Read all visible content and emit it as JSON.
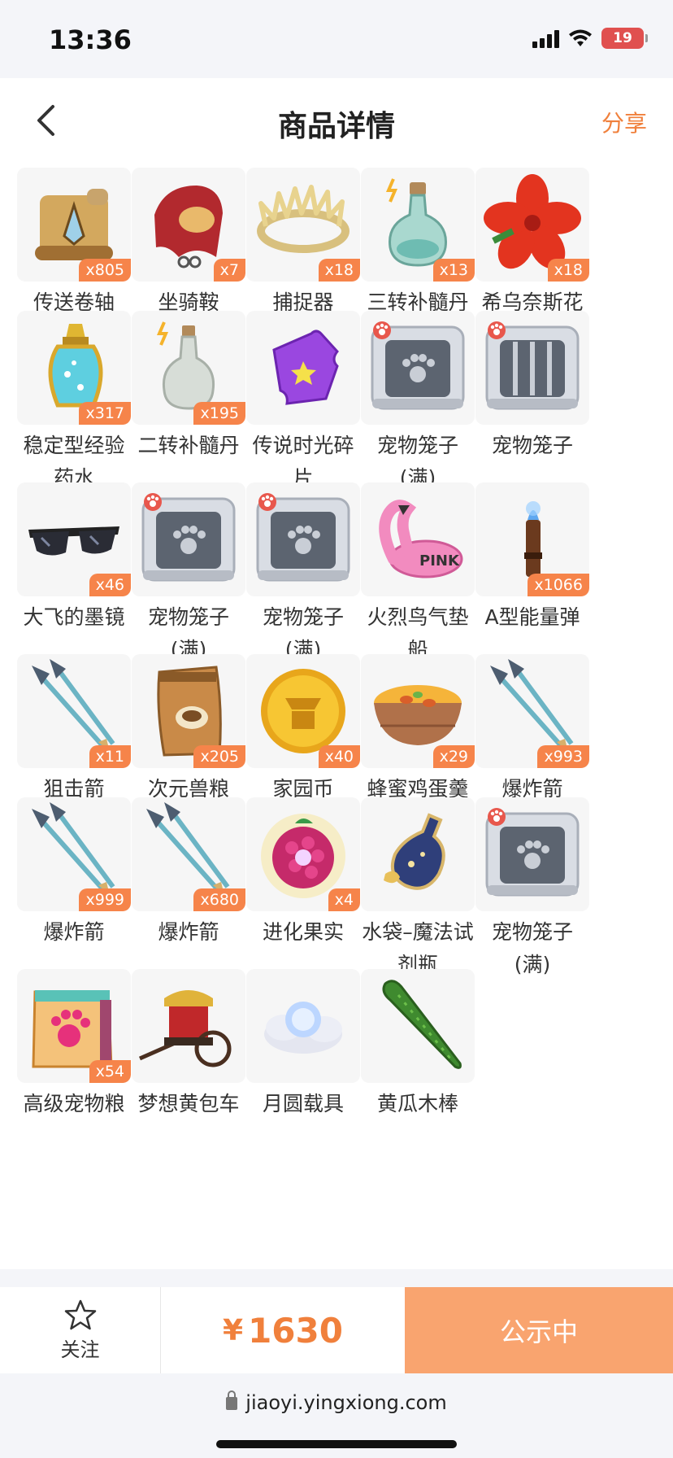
{
  "status_bar": {
    "time": "13:36",
    "battery": "19"
  },
  "header": {
    "title": "商品详情",
    "share": "分享"
  },
  "items": [
    {
      "name": "传送卷轴",
      "qty": "x805",
      "icon": "scroll-icon"
    },
    {
      "name": "坐骑鞍",
      "qty": "x7",
      "icon": "saddle-icon"
    },
    {
      "name": "捕捉器",
      "qty": "x18",
      "icon": "crown-trap-icon"
    },
    {
      "name": "三转补髓丹",
      "qty": "x13",
      "icon": "potion-bottle-icon"
    },
    {
      "name": "希乌奈斯花",
      "qty": "x18",
      "icon": "flower-icon"
    },
    {
      "name": "稳定型经验药水",
      "qty": "x317",
      "icon": "exp-potion-icon"
    },
    {
      "name": "二转补髓丹",
      "qty": "x195",
      "icon": "bottle-icon"
    },
    {
      "name": "传说时光碎片",
      "qty": "",
      "icon": "puzzle-shard-icon"
    },
    {
      "name": "宠物笼子(满)",
      "qty": "",
      "icon": "pet-cage-full-icon"
    },
    {
      "name": "宠物笼子",
      "qty": "",
      "icon": "pet-cage-empty-icon"
    },
    {
      "name": "大飞的墨镜",
      "qty": "x46",
      "icon": "sunglasses-icon"
    },
    {
      "name": "宠物笼子(满)",
      "qty": "",
      "icon": "pet-cage-full-icon"
    },
    {
      "name": "宠物笼子(满)",
      "qty": "",
      "icon": "pet-cage-full-icon"
    },
    {
      "name": "火烈鸟气垫船",
      "qty": "",
      "icon": "flamingo-float-icon"
    },
    {
      "name": "A型能量弹",
      "qty": "x1066",
      "icon": "energy-bullet-icon"
    },
    {
      "name": "狙击箭",
      "qty": "x11",
      "icon": "arrow-icon"
    },
    {
      "name": "次元兽粮",
      "qty": "x205",
      "icon": "food-bag-icon"
    },
    {
      "name": "家园币",
      "qty": "x40",
      "icon": "coin-icon"
    },
    {
      "name": "蜂蜜鸡蛋羹",
      "qty": "x29",
      "icon": "egg-custard-icon"
    },
    {
      "name": "爆炸箭",
      "qty": "x993",
      "icon": "arrow-icon"
    },
    {
      "name": "爆炸箭",
      "qty": "x999",
      "icon": "arrow-icon"
    },
    {
      "name": "爆炸箭",
      "qty": "x680",
      "icon": "arrow-icon"
    },
    {
      "name": "进化果实",
      "qty": "x4",
      "icon": "berry-icon"
    },
    {
      "name": "水袋–魔法试剂瓶",
      "qty": "",
      "icon": "magic-flask-icon"
    },
    {
      "name": "宠物笼子(满)",
      "qty": "",
      "icon": "pet-cage-full-icon"
    },
    {
      "name": "高级宠物粮",
      "qty": "x54",
      "icon": "pet-food-bag-icon"
    },
    {
      "name": "梦想黄包车",
      "qty": "",
      "icon": "rickshaw-icon"
    },
    {
      "name": "月圆载具",
      "qty": "",
      "icon": "moon-cloud-icon"
    },
    {
      "name": "黄瓜木棒",
      "qty": "",
      "icon": "cucumber-icon"
    }
  ],
  "bottom_bar": {
    "follow": "关注",
    "currency": "¥",
    "price": "1630",
    "status": "公示中"
  },
  "url_bar": {
    "url": "jiaoyi.yingxiong.com"
  }
}
